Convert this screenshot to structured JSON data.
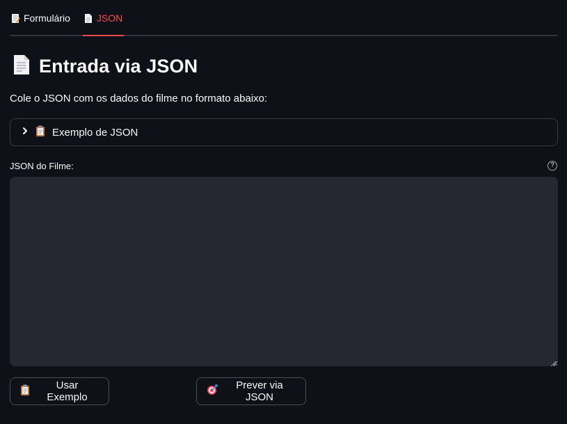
{
  "tabs": [
    {
      "label": "Formulário",
      "icon": "memo-icon",
      "active": false
    },
    {
      "label": "JSON",
      "icon": "page-icon",
      "active": true
    }
  ],
  "header": {
    "icon": "page-facing-up-icon",
    "title": "Entrada via JSON",
    "subtitle": "Cole o JSON com os dados do filme no formato abaixo:"
  },
  "expander": {
    "label": "Exemplo de JSON",
    "icon": "clipboard-icon",
    "expanded": false
  },
  "json_field": {
    "label": "JSON do Filme:",
    "value": "",
    "placeholder": ""
  },
  "buttons": {
    "use_example": "Usar Exemplo",
    "predict": "Prever via JSON"
  },
  "colors": {
    "background": "#0e1117",
    "accent": "#ff4b4b",
    "input_bg": "#262730",
    "border": "#3b3d46"
  }
}
